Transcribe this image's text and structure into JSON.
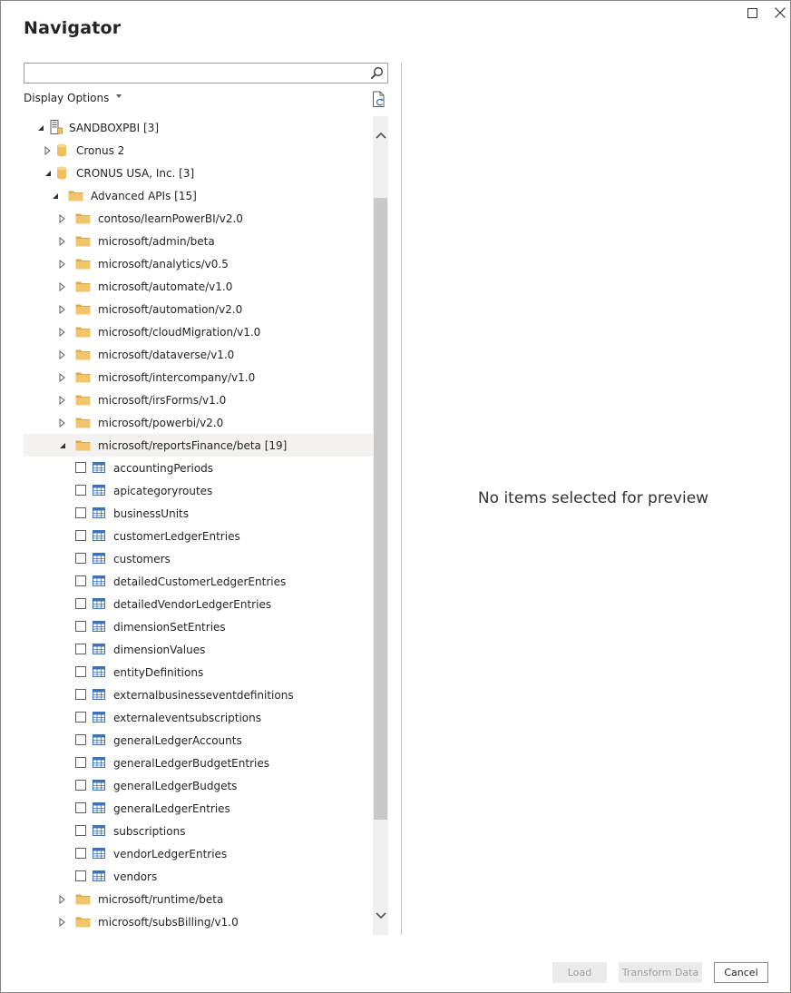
{
  "window": {
    "title": "Navigator"
  },
  "search": {
    "value": "",
    "placeholder": ""
  },
  "toolbar": {
    "display_options_label": "Display Options"
  },
  "tree": [
    {
      "label": "SANDBOXPBI [3]",
      "level": 0,
      "kind": "server",
      "expander": "open"
    },
    {
      "label": "Cronus 2",
      "level": 1,
      "kind": "database",
      "expander": "closed"
    },
    {
      "label": "CRONUS USA, Inc. [3]",
      "level": 1,
      "kind": "database",
      "expander": "open"
    },
    {
      "label": "Advanced APIs [15]",
      "level": 2,
      "kind": "folder",
      "expander": "open"
    },
    {
      "label": "contoso/learnPowerBI/v2.0",
      "level": 3,
      "kind": "folder",
      "expander": "closed"
    },
    {
      "label": "microsoft/admin/beta",
      "level": 3,
      "kind": "folder",
      "expander": "closed"
    },
    {
      "label": "microsoft/analytics/v0.5",
      "level": 3,
      "kind": "folder",
      "expander": "closed"
    },
    {
      "label": "microsoft/automate/v1.0",
      "level": 3,
      "kind": "folder",
      "expander": "closed"
    },
    {
      "label": "microsoft/automation/v2.0",
      "level": 3,
      "kind": "folder",
      "expander": "closed"
    },
    {
      "label": "microsoft/cloudMigration/v1.0",
      "level": 3,
      "kind": "folder",
      "expander": "closed"
    },
    {
      "label": "microsoft/dataverse/v1.0",
      "level": 3,
      "kind": "folder",
      "expander": "closed"
    },
    {
      "label": "microsoft/intercompany/v1.0",
      "level": 3,
      "kind": "folder",
      "expander": "closed"
    },
    {
      "label": "microsoft/irsForms/v1.0",
      "level": 3,
      "kind": "folder",
      "expander": "closed"
    },
    {
      "label": "microsoft/powerbi/v2.0",
      "level": 3,
      "kind": "folder",
      "expander": "closed"
    },
    {
      "label": "microsoft/reportsFinance/beta [19]",
      "level": 3,
      "kind": "folder",
      "expander": "open",
      "selected": true
    },
    {
      "label": "accountingPeriods",
      "level": 4,
      "kind": "table"
    },
    {
      "label": "apicategoryroutes",
      "level": 4,
      "kind": "table"
    },
    {
      "label": "businessUnits",
      "level": 4,
      "kind": "table"
    },
    {
      "label": "customerLedgerEntries",
      "level": 4,
      "kind": "table"
    },
    {
      "label": "customers",
      "level": 4,
      "kind": "table"
    },
    {
      "label": "detailedCustomerLedgerEntries",
      "level": 4,
      "kind": "table"
    },
    {
      "label": "detailedVendorLedgerEntries",
      "level": 4,
      "kind": "table"
    },
    {
      "label": "dimensionSetEntries",
      "level": 4,
      "kind": "table"
    },
    {
      "label": "dimensionValues",
      "level": 4,
      "kind": "table"
    },
    {
      "label": "entityDefinitions",
      "level": 4,
      "kind": "table"
    },
    {
      "label": "externalbusinesseventdefinitions",
      "level": 4,
      "kind": "table"
    },
    {
      "label": "externaleventsubscriptions",
      "level": 4,
      "kind": "table"
    },
    {
      "label": "generalLedgerAccounts",
      "level": 4,
      "kind": "table"
    },
    {
      "label": "generalLedgerBudgetEntries",
      "level": 4,
      "kind": "table"
    },
    {
      "label": "generalLedgerBudgets",
      "level": 4,
      "kind": "table"
    },
    {
      "label": "generalLedgerEntries",
      "level": 4,
      "kind": "table"
    },
    {
      "label": "subscriptions",
      "level": 4,
      "kind": "table"
    },
    {
      "label": "vendorLedgerEntries",
      "level": 4,
      "kind": "table"
    },
    {
      "label": "vendors",
      "level": 4,
      "kind": "table"
    },
    {
      "label": "microsoft/runtime/beta",
      "level": 3,
      "kind": "folder",
      "expander": "closed"
    },
    {
      "label": "microsoft/subsBilling/v1.0",
      "level": 3,
      "kind": "folder",
      "expander": "closed"
    }
  ],
  "preview": {
    "empty_message": "No items selected for preview"
  },
  "buttons": {
    "load_label": "Load",
    "transform_label": "Transform Data",
    "cancel_label": "Cancel"
  },
  "colors": {
    "folder": "#f2c46b",
    "folder_dark": "#dcaa4a",
    "database": "#f0c060",
    "table": "#3b73b9",
    "selected_row": "#f3f2f1"
  }
}
